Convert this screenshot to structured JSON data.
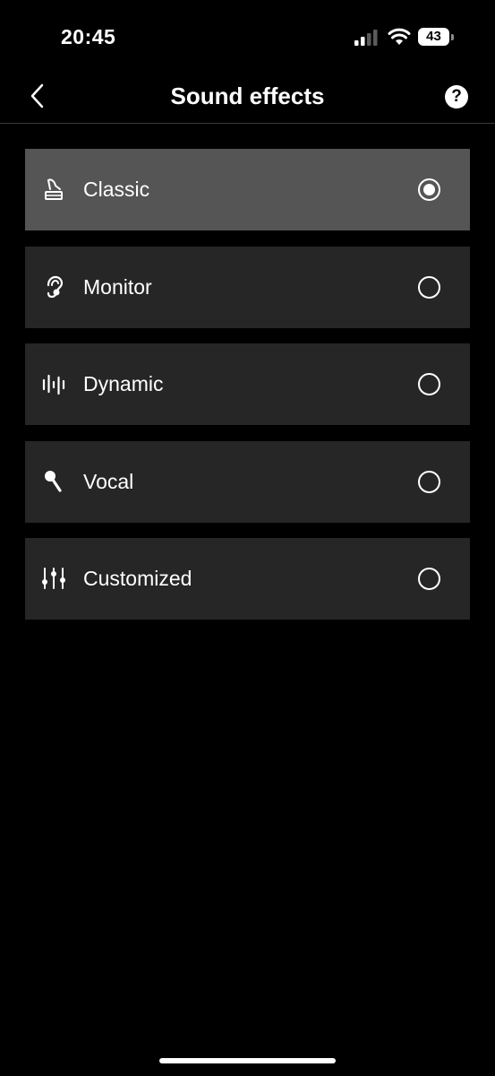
{
  "status_bar": {
    "time": "20:45",
    "battery": "43",
    "icons": [
      "signal-icon",
      "wifi-icon",
      "battery-icon"
    ]
  },
  "nav": {
    "title": "Sound effects",
    "back_icon": "chevron-left-icon",
    "help_label": "?"
  },
  "effects": [
    {
      "label": "Classic",
      "icon": "gramophone-icon",
      "selected": true
    },
    {
      "label": "Monitor",
      "icon": "ear-icon",
      "selected": false
    },
    {
      "label": "Dynamic",
      "icon": "waveform-icon",
      "selected": false
    },
    {
      "label": "Vocal",
      "icon": "microphone-icon",
      "selected": false
    },
    {
      "label": "Customized",
      "icon": "equalizer-sliders-icon",
      "selected": false
    }
  ],
  "colors": {
    "background": "#000000",
    "item_background": "#262626",
    "item_selected_background": "#555555",
    "text": "#ffffff"
  }
}
